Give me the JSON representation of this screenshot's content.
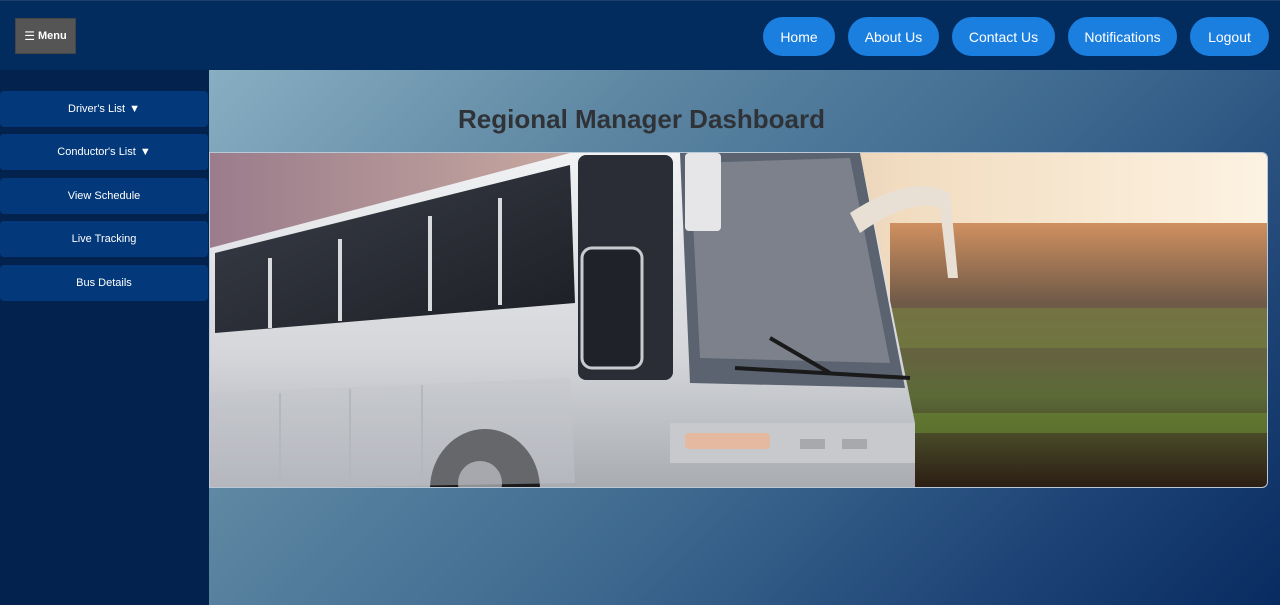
{
  "header": {
    "menu_icon": "☰",
    "menu_label": "Menu",
    "nav": [
      "Home",
      "About Us",
      "Contact Us",
      "Notifications",
      "Logout"
    ]
  },
  "sidebar": {
    "items": [
      {
        "label": "Driver's List",
        "caret": "▼"
      },
      {
        "label": "Conductor's List",
        "caret": "▼"
      },
      {
        "label": "View Schedule"
      },
      {
        "label": "Live Tracking"
      },
      {
        "label": "Bus Details"
      }
    ]
  },
  "main": {
    "title": "Regional Manager Dashboard",
    "banner_image": "white-coach-bus-in-motion"
  },
  "colors": {
    "topbar": "#022b5e",
    "nav_button": "#1b7fe0",
    "sidebar": "#03224e",
    "sidebar_item": "#03397a",
    "menu_button": "#555555",
    "title_text": "#2f3338"
  }
}
